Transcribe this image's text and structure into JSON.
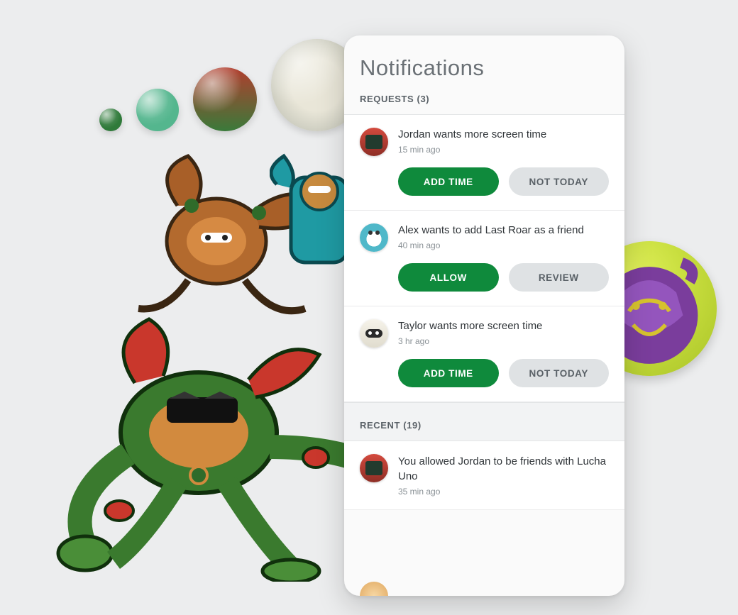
{
  "panel": {
    "title": "Notifications",
    "requests_label": "REQUESTS (3)",
    "recent_label": "RECENT (19)"
  },
  "requests": [
    {
      "avatar": "av-red",
      "message": "Jordan wants more screen time",
      "time": "15 min ago",
      "primary": "ADD TIME",
      "secondary": "NOT TODAY"
    },
    {
      "avatar": "av-owl",
      "message": "Alex wants to add Last Roar as a friend",
      "time": "40 min ago",
      "primary": "ALLOW",
      "secondary": "REVIEW"
    },
    {
      "avatar": "av-ninja",
      "message": "Taylor wants more screen time",
      "time": "3 hr ago",
      "primary": "ADD TIME",
      "secondary": "NOT TODAY"
    }
  ],
  "recent": [
    {
      "avatar": "av-red",
      "message": "You allowed Jordan to be friends with Lucha Uno",
      "time": "35 min ago"
    }
  ]
}
